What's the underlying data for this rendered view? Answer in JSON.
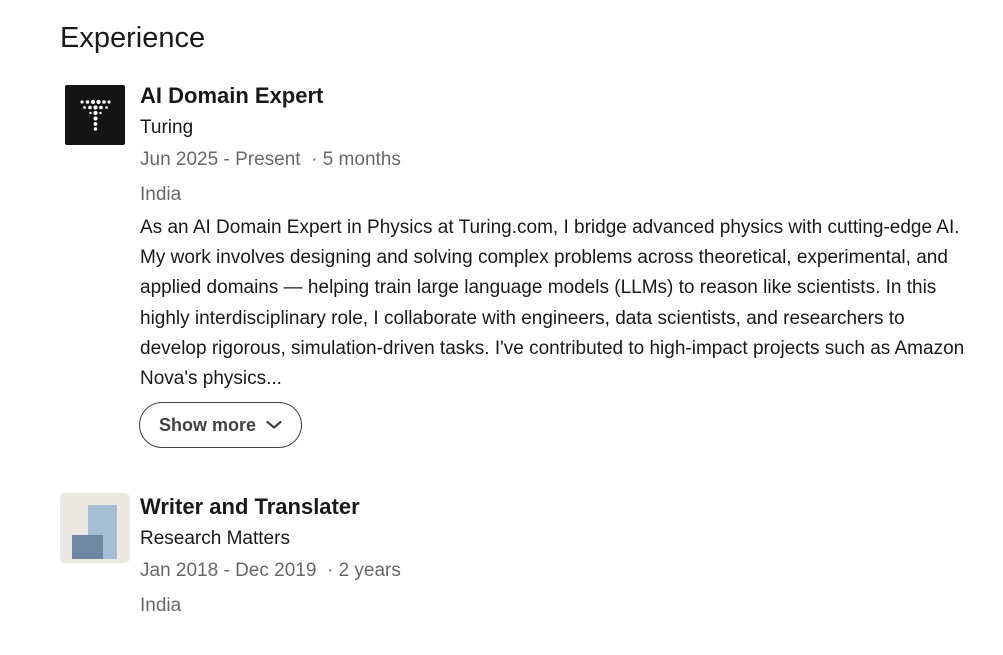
{
  "section": {
    "title": "Experience"
  },
  "experiences": [
    {
      "title": "AI Domain Expert",
      "company": "Turing",
      "date_range": "Jun 2025 - Present",
      "duration": "· 5 months",
      "location": "India",
      "description": "As an AI Domain Expert in Physics at Turing.com, I bridge advanced physics with cutting-edge AI. My work involves designing and solving complex problems across theoretical, experimental, and applied domains — helping train large language models (LLMs) to reason like scientists. In this highly interdisciplinary role, I collaborate with engineers, data scientists, and researchers to develop rigorous, simulation-driven tasks. I've contributed to high-impact projects such as Amazon Nova's physics...",
      "show_more_label": "Show more",
      "logo_icon": "turing-logo-icon"
    },
    {
      "title": "Writer and Translater",
      "company": "Research Matters",
      "date_range": "Jan 2018 - Dec 2019",
      "duration": "· 2 years",
      "location": "India",
      "logo_icon": "company-placeholder-logo-icon"
    }
  ],
  "colors": {
    "text_primary": "#1a1a1a",
    "text_secondary": "#666666",
    "turing_logo_bg": "#141414",
    "placeholder_logo_bg": "#ebe7e2",
    "placeholder_light_block": "#a7bdd3",
    "placeholder_dark_block": "#6f87a1"
  }
}
